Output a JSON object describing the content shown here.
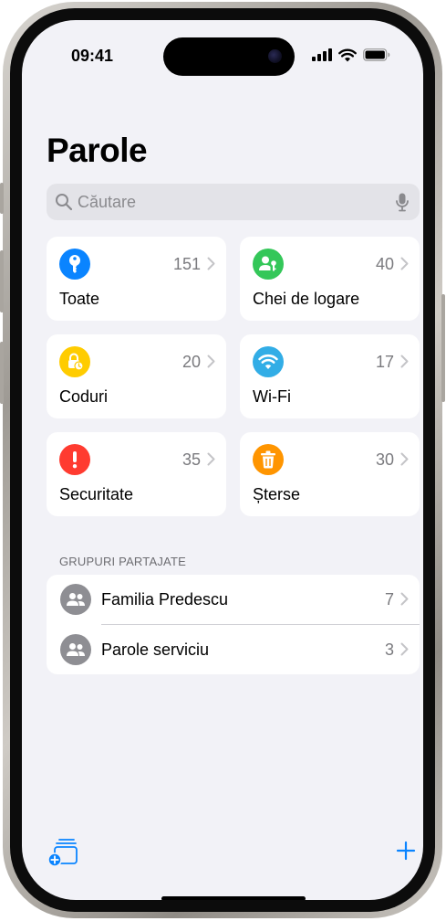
{
  "status_bar": {
    "time": "09:41"
  },
  "header": {
    "title": "Parole"
  },
  "search": {
    "placeholder": "Căutare"
  },
  "categories": [
    {
      "label": "Toate",
      "count": "151",
      "icon": "key-icon",
      "color": "#0a84ff"
    },
    {
      "label": "Chei de logare",
      "count": "40",
      "icon": "passkey-person-icon",
      "color": "#34c759"
    },
    {
      "label": "Coduri",
      "count": "20",
      "icon": "lock-clock-icon",
      "color": "#ffcc00"
    },
    {
      "label": "Wi-Fi",
      "count": "17",
      "icon": "wifi-icon",
      "color": "#32ade6"
    },
    {
      "label": "Securitate",
      "count": "35",
      "icon": "exclamation-icon",
      "color": "#ff3b30"
    },
    {
      "label": "Șterse",
      "count": "30",
      "icon": "trash-icon",
      "color": "#ff9500"
    }
  ],
  "shared_groups": {
    "header": "GRUPURI PARTAJATE",
    "items": [
      {
        "name": "Familia Predescu",
        "count": "7",
        "icon": "people-icon"
      },
      {
        "name": "Parole serviciu",
        "count": "3",
        "icon": "people-icon"
      }
    ]
  },
  "toolbar": {
    "new_group_icon": "new-shared-group-icon",
    "add_icon": "plus-icon"
  },
  "colors": {
    "accent": "#0a84ff",
    "background": "#f2f2f7"
  }
}
